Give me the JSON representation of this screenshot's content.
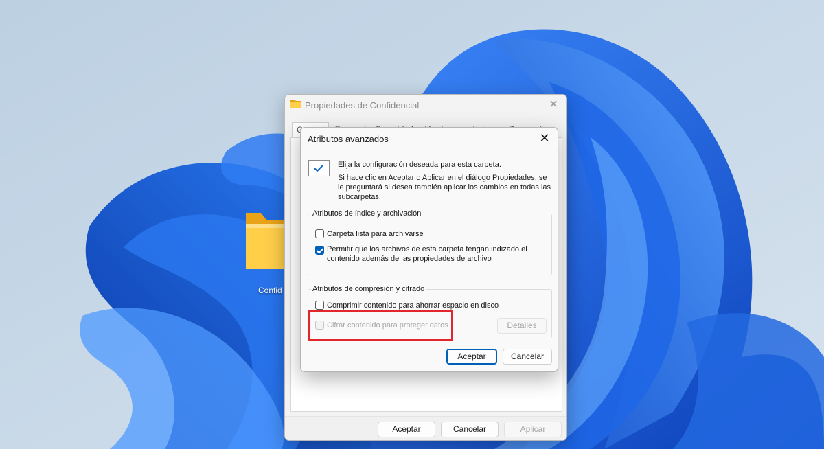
{
  "desktop": {
    "folder_label": "Confid"
  },
  "props_window": {
    "title": "Propiedades de Confidencial",
    "tabs": [
      "General",
      "Compartir",
      "Seguridad",
      "Versiones anteriores",
      "Personalizar"
    ],
    "buttons": {
      "accept": "Aceptar",
      "cancel": "Cancelar",
      "apply": "Aplicar"
    }
  },
  "advanced_dialog": {
    "title": "Atributos avanzados",
    "intro_line1": "Elija la configuración deseada para esta carpeta.",
    "intro_line2": "Si hace clic en Aceptar o Aplicar en el diálogo Propiedades, se le preguntará si desea también aplicar los cambios en todas las subcarpetas.",
    "index_group": {
      "label": "Atributos de índice y archivación",
      "archive_label": "Carpeta lista para archivarse",
      "archive_checked": false,
      "index_label": "Permitir que los archivos de esta carpeta tengan indizado el contenido además de las propiedades de archivo",
      "index_checked": true
    },
    "compress_group": {
      "label": "Atributos de compresión y cifrado",
      "compress_label": "Comprimir contenido para ahorrar espacio en disco",
      "compress_checked": false,
      "encrypt_label": "Cifrar contenido para proteger datos",
      "encrypt_checked": false,
      "details_button": "Detalles"
    },
    "buttons": {
      "accept": "Aceptar",
      "cancel": "Cancelar"
    }
  },
  "colors": {
    "accent": "#005fb8",
    "highlight": "#e1262d",
    "wallpaper_blue": "#1f6fe0"
  }
}
